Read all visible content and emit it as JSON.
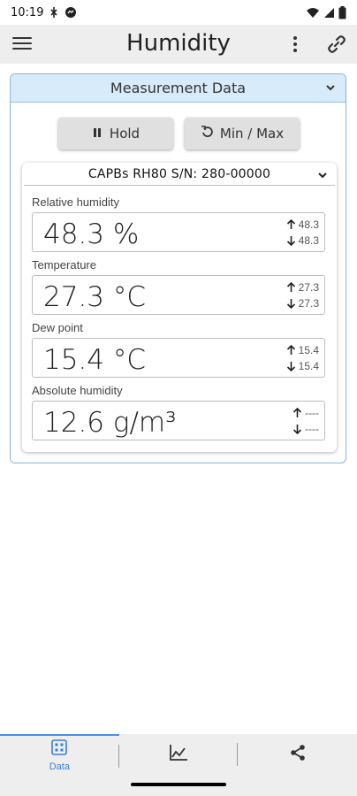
{
  "status_bar": {
    "time": "10:19",
    "icons_left": [
      "signal-app-icon",
      "messenger-app-icon"
    ],
    "icons_right": [
      "wifi-icon",
      "cellular-signal-icon",
      "battery-icon"
    ]
  },
  "app_bar": {
    "title": "Humidity",
    "menu_icon": "menu-icon",
    "more_icon": "more-vert-icon",
    "link_icon": "link-icon"
  },
  "panel": {
    "title": "Measurement Data",
    "hold_label": "Hold",
    "minmax_label": "Min / Max"
  },
  "device": {
    "title": "CAPBs RH80 S/N: 280-00000"
  },
  "measurements": [
    {
      "label": "Relative humidity",
      "value": "48.3 %",
      "max": "48.3",
      "min": "48.3"
    },
    {
      "label": "Temperature",
      "value": "27.3 °C",
      "max": "27.3",
      "min": "27.3"
    },
    {
      "label": "Dew point",
      "value": "15.4 °C",
      "max": "15.4",
      "min": "15.4"
    },
    {
      "label": "Absolute humidity",
      "value": "12.6 g/m³",
      "max": "----",
      "min": "----"
    }
  ],
  "bottom_nav": {
    "items": [
      {
        "label": "Data",
        "icon": "grid-icon",
        "active": true
      },
      {
        "label": "",
        "icon": "chart-icon",
        "active": false
      },
      {
        "label": "",
        "icon": "share-icon",
        "active": false
      }
    ]
  },
  "colors": {
    "accent": "#3a7dd1",
    "panel_header": "#d8ebfa",
    "app_bar": "#eeeeee"
  }
}
